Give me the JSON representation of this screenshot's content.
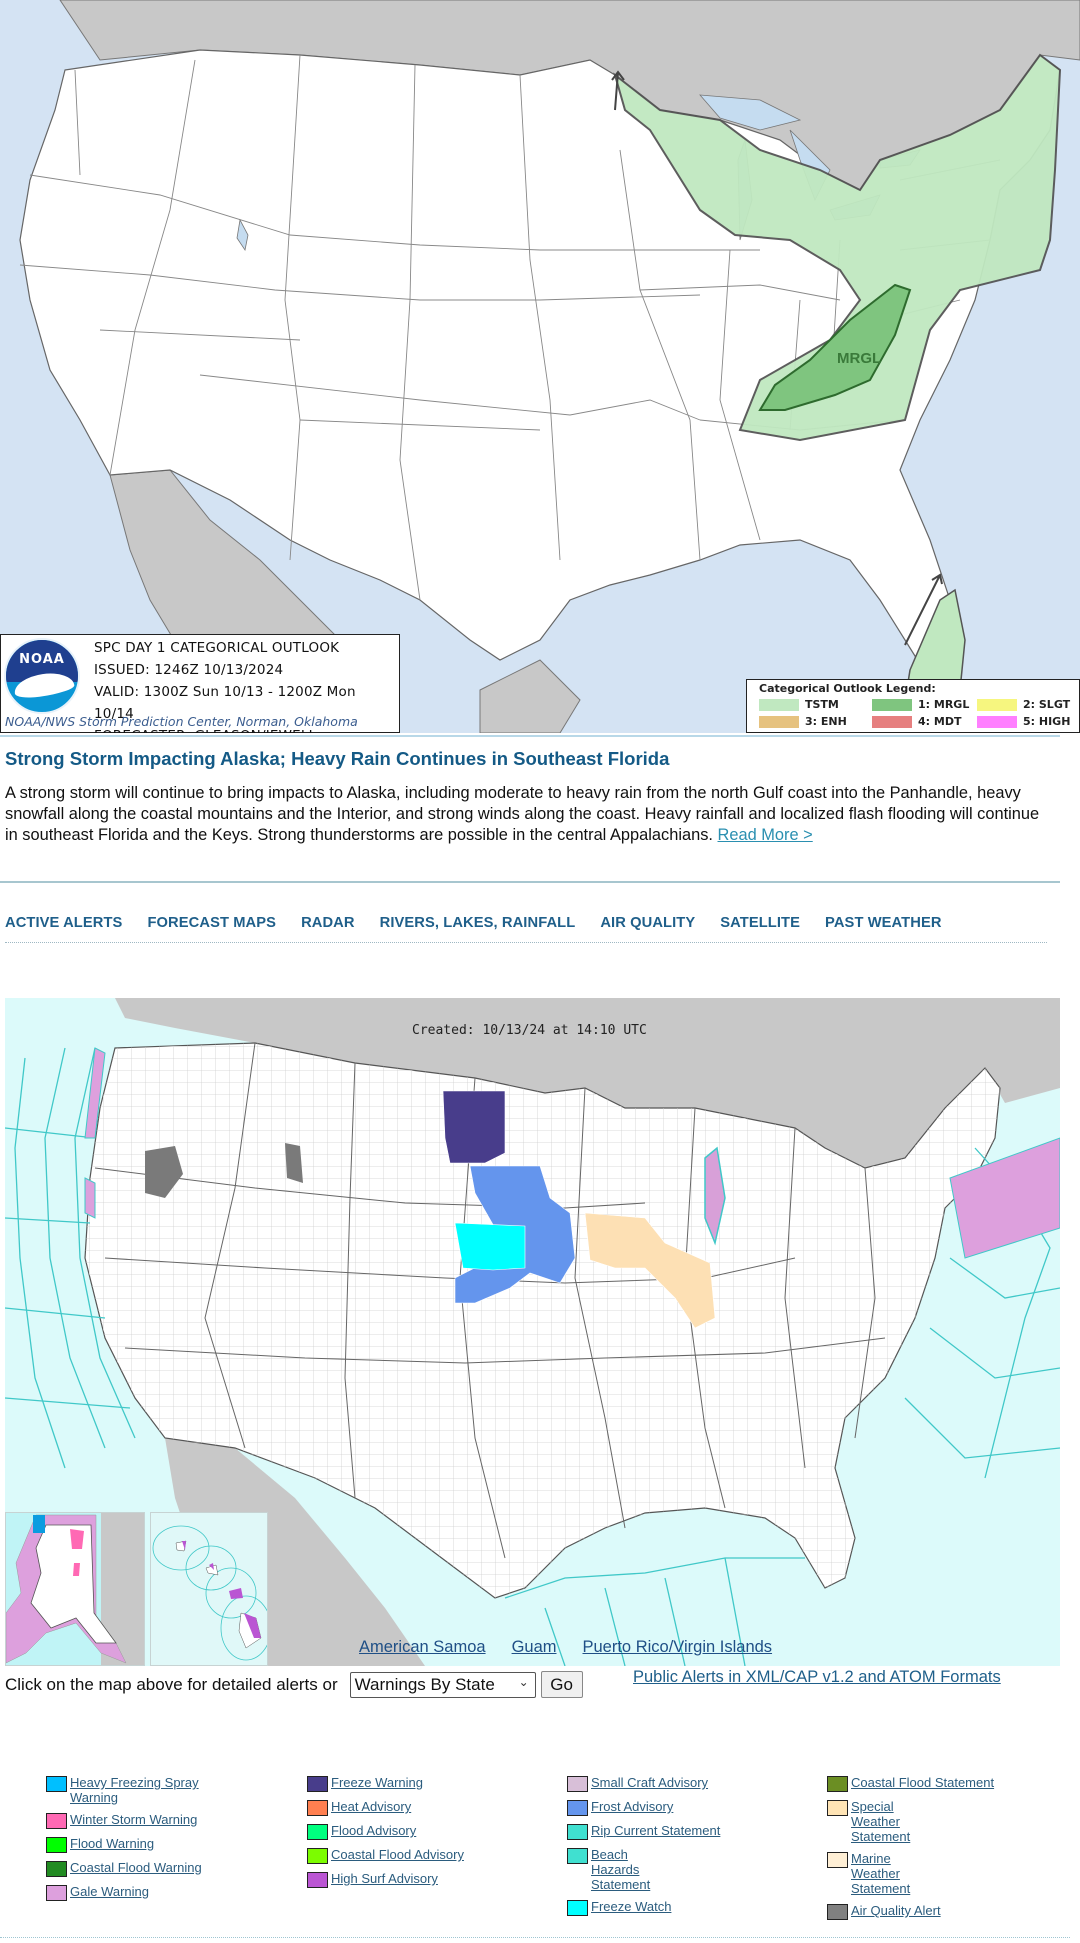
{
  "spc_outlook": {
    "title": "SPC DAY 1 CATEGORICAL OUTLOOK",
    "issued": "ISSUED: 1246Z 10/13/2024",
    "valid": "VALID: 1300Z Sun 10/13 - 1200Z Mon 10/14",
    "forecaster": "FORECASTER: GLEASON/JEWELL",
    "credit": "NOAA/NWS Storm Prediction Center, Norman, Oklahoma",
    "logo_text": "NOAA",
    "map_label": "MRGL",
    "legend": {
      "title": "Categorical Outlook Legend:",
      "items": [
        {
          "label": "TSTM",
          "color": "#c0e8c0"
        },
        {
          "label": "1: MRGL",
          "color": "#7fc57f"
        },
        {
          "label": "2: SLGT",
          "color": "#f6f67f"
        },
        {
          "label": "3: ENH",
          "color": "#e6c27f"
        },
        {
          "label": "4: MDT",
          "color": "#e67f7f"
        },
        {
          "label": "5: HIGH",
          "color": "#ff7fff"
        }
      ]
    }
  },
  "headline": {
    "title": "Strong Storm Impacting Alaska; Heavy Rain Continues in Southeast Florida",
    "summary": "A strong storm will continue to bring impacts to Alaska, including moderate to heavy rain from the north Gulf coast into the Panhandle, heavy snowfall along the coastal mountains and the Interior, and strong winds along the coast. Heavy rainfall and localized flash flooding will continue in southeast Florida and the Keys. Strong thunderstorms are possible in the central Appalachians.",
    "read_more": "Read More >"
  },
  "nav": {
    "items": [
      "ACTIVE ALERTS",
      "FORECAST MAPS",
      "RADAR",
      "RIVERS, LAKES, RAINFALL",
      "AIR QUALITY",
      "SATELLITE",
      "PAST WEATHER"
    ]
  },
  "alerts_map": {
    "created": "Created: 10/13/24 at 14:10 UTC",
    "territory_links": [
      "American Samoa",
      "Guam",
      "Puerto Rico/Virgin Islands"
    ]
  },
  "controls": {
    "label": "Click on the map above for detailed alerts or",
    "select_value": "Warnings By State",
    "go_label": "Go",
    "xml_link": "Public Alerts in XML/CAP v1.2 and ATOM Formats"
  },
  "legend": {
    "columns": [
      [
        {
          "label": "Heavy Freezing Spray Warning",
          "color": "#00bfff"
        },
        {
          "label": "Winter Storm Warning",
          "color": "#ff69b4"
        },
        {
          "label": "Flood Warning",
          "color": "#00ff00"
        },
        {
          "label": "Coastal Flood Warning",
          "color": "#228b22"
        },
        {
          "label": "Gale Warning",
          "color": "#dda0dd"
        }
      ],
      [
        {
          "label": "Freeze Warning",
          "color": "#483d8b"
        },
        {
          "label": "Heat Advisory",
          "color": "#ff7f50"
        },
        {
          "label": "Flood Advisory",
          "color": "#00ff7f"
        },
        {
          "label": "Coastal Flood Advisory",
          "color": "#7cfc00"
        },
        {
          "label": "High Surf Advisory",
          "color": "#ba55d3"
        }
      ],
      [
        {
          "label": "Small Craft Advisory",
          "color": "#d8bfd8"
        },
        {
          "label": "Frost Advisory",
          "color": "#6495ed"
        },
        {
          "label": "Rip Current Statement",
          "color": "#40e0d0"
        },
        {
          "label": "Beach Hazards Statement",
          "color": "#40e0d0"
        },
        {
          "label": "Freeze Watch",
          "color": "#00ffff"
        }
      ],
      [
        {
          "label": "Coastal Flood Statement",
          "color": "#6b8e23"
        },
        {
          "label": "Special Weather Statement",
          "color": "#ffe4b5"
        },
        {
          "label": "Marine Weather Statement",
          "color": "#ffefd5"
        },
        {
          "label": "Air Quality Alert",
          "color": "#808080"
        }
      ]
    ]
  }
}
